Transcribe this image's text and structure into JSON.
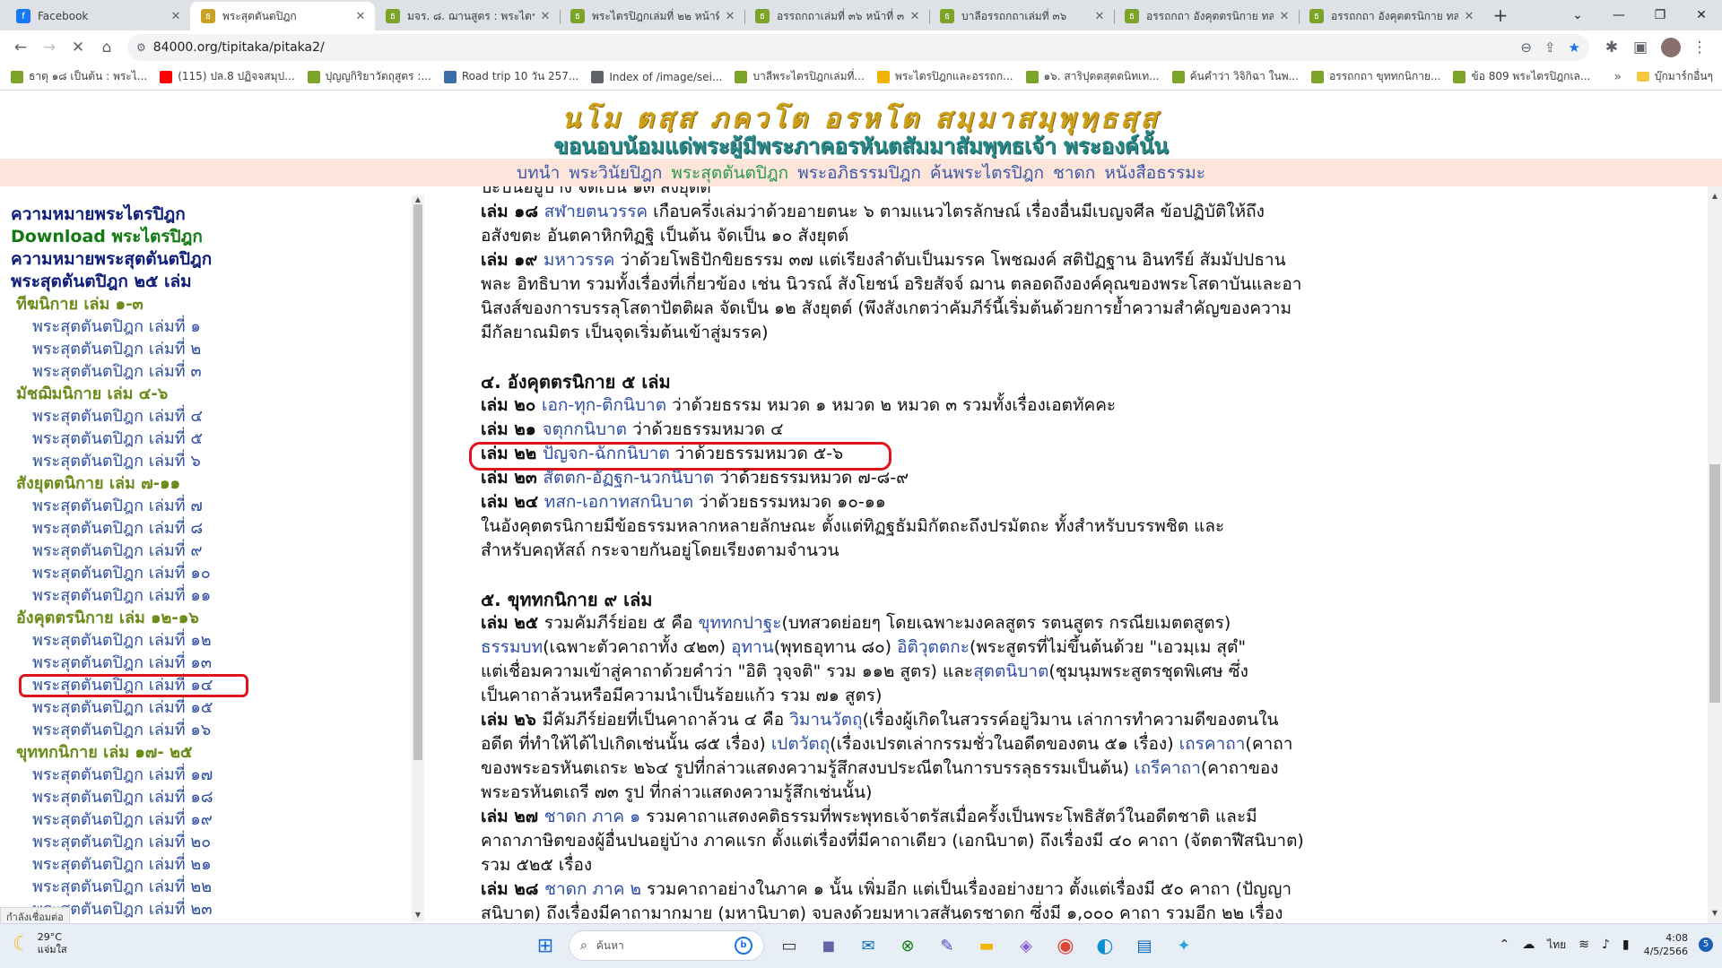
{
  "browser": {
    "tabs": [
      {
        "title": "Facebook",
        "icon": "facebook-icon",
        "color": "#1877f2",
        "glyph": "f"
      },
      {
        "title": "พระสุตตันตปิฎก",
        "icon": "tipitaka-icon",
        "color": "#c9a227",
        "glyph": "ธ",
        "active": true
      },
      {
        "title": "มจร. ๘. ฌานสูตร : พระไตรปิฎก",
        "icon": "tipitaka-icon",
        "color": "#7ba428",
        "glyph": "ธ"
      },
      {
        "title": "พระไตรปิฎกเล่มที่ ๒๒ หน้าที่ ๒",
        "icon": "tipitaka-icon",
        "color": "#7ba428",
        "glyph": "ธ"
      },
      {
        "title": "อรรถกถาเล่มที่ ๓๖ หน้าที่ ๓๐๘",
        "icon": "tipitaka-icon",
        "color": "#7ba428",
        "glyph": "ธ"
      },
      {
        "title": "บาลีอรรถกถาเล่มที่ ๓๖",
        "icon": "tipitaka-icon",
        "color": "#7ba428",
        "glyph": "ธ"
      },
      {
        "title": "อรรถกถา อังคุตตรนิกาย ทสกนิ",
        "icon": "tipitaka-icon",
        "color": "#7ba428",
        "glyph": "ธ"
      },
      {
        "title": "อรรถกถา อังคุตตรนิกาย ทสกนิ",
        "icon": "tipitaka-icon",
        "color": "#7ba428",
        "glyph": "ธ"
      }
    ],
    "url": "84000.org/tipitaka/pitaka2/",
    "bookmarks": [
      {
        "label": "ธาตุ ๑๘ เป็นต้น : พระไ...",
        "color": "#7ba428"
      },
      {
        "label": "(115) ปล.8 ปฏิจจสมุป...",
        "color": "#ff0000"
      },
      {
        "label": "ปุญญกิริยาวัตถุสูตร :...",
        "color": "#7ba428"
      },
      {
        "label": "Road trip 10 วัน 257...",
        "color": "#3b6ea8"
      },
      {
        "label": "Index of /image/sei...",
        "color": "#5f6368"
      },
      {
        "label": "บาลีพระไตรปิฎกเล่มที่...",
        "color": "#7ba428"
      },
      {
        "label": "พระไตรปิฎกและอรรถก...",
        "color": "#f0b400"
      },
      {
        "label": "๑๖. สาริปุตตสุตตนิทเท...",
        "color": "#7ba428"
      },
      {
        "label": "ค้นคำว่า วิจิกิฉา ในพ...",
        "color": "#7ba428"
      },
      {
        "label": "อรรถกถา ขุททกนิกาย...",
        "color": "#7ba428"
      },
      {
        "label": "ข้อ 809 พระไตรปิฎกเล...",
        "color": "#7ba428"
      }
    ],
    "other_bookmarks": "บุ๊กมาร์กอื่นๆ",
    "status": "กำลังเชื่อมต่อ"
  },
  "site": {
    "motto": "นโม ตสฺส ภควโต อรหโต สมฺมาสมฺพุทฺธสฺส",
    "motto_sub": "ขอนอบน้อมแด่พระผู้มีพระภาคอรหันตสัมมาสัมพุทธเจ้า พระองค์นั้น",
    "nav": [
      "บทนำ",
      "พระวินัยปิฎก",
      "พระสุตตันตปิฎก",
      "พระอภิธรรมปิฎก",
      "ค้นพระไตรปิฎก",
      "ชาดก",
      "หนังสือธรรมะ"
    ]
  },
  "sidebar": {
    "links": [
      "ความหมายพระไตรปิฎก",
      "Download พระไตรปิฎก",
      "ความหมายพระสุตตันตปิฎก",
      "พระสุตตันตปิฎก ๒๕ เล่ม"
    ],
    "groups": [
      {
        "title": "ทีฆนิกาย เล่ม ๑-๓",
        "vols": [
          "พระสุตตันตปิฎก เล่มที่ ๑",
          "พระสุตตันตปิฎก เล่มที่ ๒",
          "พระสุตตันตปิฎก เล่มที่ ๓"
        ]
      },
      {
        "title": "มัชฌิมนิกาย เล่ม ๔-๖",
        "vols": [
          "พระสุตตันตปิฎก เล่มที่ ๔",
          "พระสุตตันตปิฎก เล่มที่ ๕",
          "พระสุตตันตปิฎก เล่มที่ ๖"
        ]
      },
      {
        "title": "สังยุตตนิกาย เล่ม ๗-๑๑",
        "vols": [
          "พระสุตตันตปิฎก เล่มที่ ๗",
          "พระสุตตันตปิฎก เล่มที่ ๘",
          "พระสุตตันตปิฎก เล่มที่ ๙",
          "พระสุตตันตปิฎก เล่มที่ ๑๐",
          "พระสุตตันตปิฎก เล่มที่ ๑๑"
        ]
      },
      {
        "title": "อังคุตตรนิกาย เล่ม ๑๒-๑๖",
        "vols": [
          "พระสุตตันตปิฎก เล่มที่ ๑๒",
          "พระสุตตันตปิฎก เล่มที่ ๑๓",
          "พระสุตตันตปิฎก เล่มที่ ๑๔",
          "พระสุตตันตปิฎก เล่มที่ ๑๕",
          "พระสุตตันตปิฎก เล่มที่ ๑๖"
        ]
      },
      {
        "title": "ขุททกนิกาย เล่ม ๑๗- ๒๕",
        "vols": [
          "พระสุตตันตปิฎก เล่มที่ ๑๗",
          "พระสุตตันตปิฎก เล่มที่ ๑๘",
          "พระสุตตันตปิฎก เล่มที่ ๑๙",
          "พระสุตตันตปิฎก เล่มที่ ๒๐",
          "พระสุตตันตปิฎก เล่มที่ ๒๑",
          "พระสุตตันตปิฎก เล่มที่ ๒๒",
          "พระสุตตันตปิฎก เล่มที่ ๒๓"
        ]
      }
    ]
  },
  "content": {
    "lines": [
      [
        {
          "t": "ปะปนอยู่บ้าง จัดเป็น ๑๓ สังยุตต์"
        }
      ],
      [
        {
          "t": "เล่ม ๑๘ ",
          "b": true
        },
        {
          "t": "สฬายตนวรรค",
          "a": true
        },
        {
          "t": " เกือบครึ่งเล่มว่าด้วยอายตนะ ๖ ตามแนวไตรลักษณ์ เรื่องอื่นมีเบญจศีล ข้อปฏิบัติให้ถึง"
        }
      ],
      [
        {
          "t": "อสังขตะ อันตคาหิกทิฏฐิ เป็นต้น จัดเป็น ๑๐ สังยุตต์"
        }
      ],
      [
        {
          "t": "เล่ม ๑๙ ",
          "b": true
        },
        {
          "t": "มหาวรรค",
          "a": true
        },
        {
          "t": " ว่าด้วยโพธิปักขิยธรรม ๓๗ แต่เรียงลำดับเป็นมรรค โพชฌงค์ สติปัฏฐาน อินทรีย์ สัมมัปปธาน"
        }
      ],
      [
        {
          "t": "พละ อิทธิบาท รวมทั้งเรื่องที่เกี่ยวข้อง เช่น นิวรณ์ สังโยชน์ อริยสัจจ์ ฌาน ตลอดถึงองค์คุณของพระโสดาบันและอา"
        }
      ],
      [
        {
          "t": "นิสงส์ของการบรรลุโสดาปัตติผล จัดเป็น ๑๒ สังยุตต์ (พึงสังเกตว่าคัมภีร์นี้เริ่มต้นด้วยการย้ำความสำคัญของความ"
        }
      ],
      [
        {
          "t": "มีกัลยาณมิตร เป็นจุดเริ่มต้นเข้าสู่มรรค)"
        }
      ],
      [
        {
          "t": "๔. อังคุตตรนิกาย ๕ เล่ม",
          "h": true
        }
      ],
      [
        {
          "t": "เล่ม ๒๐ ",
          "b": true
        },
        {
          "t": "เอก-ทุก-ติกนิบาต",
          "a": true
        },
        {
          "t": " ว่าด้วยธรรม หมวด ๑ หมวด ๒ หมวด ๓ รวมทั้งเรื่องเอตทัคคะ"
        }
      ],
      [
        {
          "t": "เล่ม ๒๑ ",
          "b": true
        },
        {
          "t": "จตุกกนิบาต",
          "a": true
        },
        {
          "t": " ว่าด้วยธรรมหมวด ๔"
        }
      ],
      [
        {
          "t": "เล่ม ๒๒ ",
          "b": true
        },
        {
          "t": "ปัญจก-ฉักกนิบาต",
          "a": true
        },
        {
          "t": " ว่าด้วยธรรมหมวด ๕-๖"
        }
      ],
      [
        {
          "t": "เล่ม ๒๓ ",
          "b": true
        },
        {
          "t": "สัตตก-อัฏฐก-นวกนิบาต",
          "a": true
        },
        {
          "t": " ว่าด้วยธรรมหมวด ๗-๘-๙"
        }
      ],
      [
        {
          "t": "เล่ม ๒๔ ",
          "b": true
        },
        {
          "t": "ทสก-เอกาทสกนิบาต",
          "a": true
        },
        {
          "t": " ว่าด้วยธรรมหมวด ๑๐-๑๑"
        }
      ],
      [
        {
          "t": "      ในอังคุตตรนิกายมีข้อธรรมหลากหลายลักษณะ ตั้งแต่ทิฏฐธัมมิกัตถะถึงปรมัตถะ ทั้งสำหรับบรรพชิต และ"
        }
      ],
      [
        {
          "t": "สำหรับคฤหัสถ์ กระจายกันอยู่โดยเรียงตามจำนวน"
        }
      ],
      [
        {
          "t": "๕. ขุททกนิกาย ๙ เล่ม",
          "h": true
        }
      ],
      [
        {
          "t": "เล่ม ๒๕ ",
          "b": true
        },
        {
          "t": "รวมคัมภีร์ย่อย ๕ คือ "
        },
        {
          "t": "ขุททกปาฐะ",
          "a": true
        },
        {
          "t": "(บทสวดย่อยๆ โดยเฉพาะมงคลสูตร รตนสูตร กรณียเมตตสูตร)"
        }
      ],
      [
        {
          "t": "ธรรมบท",
          "a": true
        },
        {
          "t": "(เฉพาะตัวคาถาทั้ง ๔๒๓) "
        },
        {
          "t": "อุทาน",
          "a": true
        },
        {
          "t": "(พุทธอุทาน ๘๐) "
        },
        {
          "t": "อิติวุตตกะ",
          "a": true
        },
        {
          "t": "(พระสูตรที่ไม่ขึ้นต้นด้วย \"เอวมฺเม สุตํ\""
        }
      ],
      [
        {
          "t": "แต่เชื่อมความเข้าสู่คาถาด้วยคำว่า \"อิติ วุจฺจติ\" รวม ๑๑๒ สูตร) และ"
        },
        {
          "t": "สุตตนิบาต",
          "a": true
        },
        {
          "t": "(ชุมนุมพระสูตรชุดพิเศษ ซึ่ง"
        }
      ],
      [
        {
          "t": "เป็นคาถาล้วนหรือมีความนำเป็นร้อยแก้ว รวม ๗๑ สูตร)"
        }
      ],
      [
        {
          "t": "เล่ม ๒๖ ",
          "b": true
        },
        {
          "t": "มีคัมภีร์ย่อยที่เป็นคาถาล้วน ๔ คือ "
        },
        {
          "t": "วิมานวัตถุ",
          "a": true
        },
        {
          "t": "(เรื่องผู้เกิดในสวรรค์อยู่วิมาน เล่าการทำความดีของตนใน"
        }
      ],
      [
        {
          "t": "อดีต ที่ทำให้ได้ไปเกิดเช่นนั้น ๘๕ เรื่อง) "
        },
        {
          "t": "เปตวัตถุ",
          "a": true
        },
        {
          "t": "(เรื่องเปรตเล่ากรรมชั่วในอดีตของตน ๕๑ เรื่อง) "
        },
        {
          "t": "เถรคาถา",
          "a": true
        },
        {
          "t": "(คาถา"
        }
      ],
      [
        {
          "t": "ของพระอรหันตเถระ ๒๖๔ รูปที่กล่าวแสดงความรู้สึกสงบประณีตในการบรรลุธรรมเป็นต้น) "
        },
        {
          "t": "เถรีคาถา",
          "a": true
        },
        {
          "t": "(คาถาของ"
        }
      ],
      [
        {
          "t": "พระอรหันตเถรี ๗๓ รูป ที่กล่าวแสดงความรู้สึกเช่นนั้น)"
        }
      ],
      [
        {
          "t": "เล่ม ๒๗ ",
          "b": true
        },
        {
          "t": "ชาดก ภาค ๑",
          "a": true
        },
        {
          "t": " รวมคาถาแสดงคติธรรมที่พระพุทธเจ้าตรัสเมื่อครั้งเป็นพระโพธิสัตว์ในอดีตชาติ และมี"
        }
      ],
      [
        {
          "t": "คาถาภาษิตของผู้อื่นปนอยู่บ้าง ภาคแรก ตั้งแต่เรื่องที่มีคาถาเดียว (เอกนิบาต) ถึงเรื่องมี ๔๐ คาถา (จัตตาฬีสนิบาต)"
        }
      ],
      [
        {
          "t": "รวม ๕๒๕ เรื่อง"
        }
      ],
      [
        {
          "t": "เล่ม ๒๘ ",
          "b": true
        },
        {
          "t": "ชาดก ภาค ๒",
          "a": true
        },
        {
          "t": " รวมคาถาอย่างในภาค ๑ นั้น เพิ่มอีก แต่เป็นเรื่องอย่างยาว ตั้งแต่เรื่องมี ๕๐ คาถา (ปัญญา"
        }
      ],
      [
        {
          "t": "สนิบาต) ถึงเรื่องมีคาถามากมาย (มหานิบาต) จบลงด้วยมหาเวสสันดรชาดก ซึ่งมี ๑,๐๐๐ คาถา รวมอีก ๒๒ เรื่อง"
        }
      ]
    ]
  },
  "taskbar": {
    "weather_temp": "29°C",
    "weather_desc": "แจ่มใส",
    "search_placeholder": "ค้นหา",
    "lang": "ไทย",
    "time": "4:08",
    "date": "4/5/2566",
    "notifications": "5"
  }
}
